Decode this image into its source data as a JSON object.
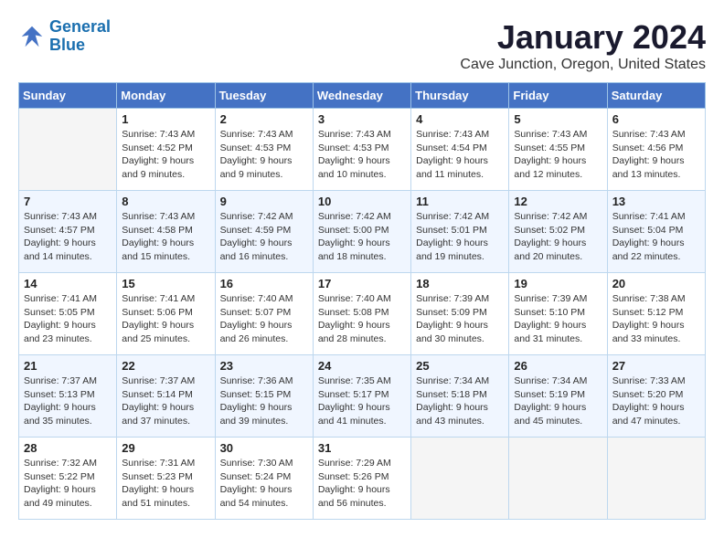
{
  "logo": {
    "line1": "General",
    "line2": "Blue"
  },
  "title": "January 2024",
  "subtitle": "Cave Junction, Oregon, United States",
  "days_of_week": [
    "Sunday",
    "Monday",
    "Tuesday",
    "Wednesday",
    "Thursday",
    "Friday",
    "Saturday"
  ],
  "weeks": [
    [
      {
        "num": "",
        "info": ""
      },
      {
        "num": "1",
        "info": "Sunrise: 7:43 AM\nSunset: 4:52 PM\nDaylight: 9 hours\nand 9 minutes."
      },
      {
        "num": "2",
        "info": "Sunrise: 7:43 AM\nSunset: 4:53 PM\nDaylight: 9 hours\nand 9 minutes."
      },
      {
        "num": "3",
        "info": "Sunrise: 7:43 AM\nSunset: 4:53 PM\nDaylight: 9 hours\nand 10 minutes."
      },
      {
        "num": "4",
        "info": "Sunrise: 7:43 AM\nSunset: 4:54 PM\nDaylight: 9 hours\nand 11 minutes."
      },
      {
        "num": "5",
        "info": "Sunrise: 7:43 AM\nSunset: 4:55 PM\nDaylight: 9 hours\nand 12 minutes."
      },
      {
        "num": "6",
        "info": "Sunrise: 7:43 AM\nSunset: 4:56 PM\nDaylight: 9 hours\nand 13 minutes."
      }
    ],
    [
      {
        "num": "7",
        "info": "Sunrise: 7:43 AM\nSunset: 4:57 PM\nDaylight: 9 hours\nand 14 minutes."
      },
      {
        "num": "8",
        "info": "Sunrise: 7:43 AM\nSunset: 4:58 PM\nDaylight: 9 hours\nand 15 minutes."
      },
      {
        "num": "9",
        "info": "Sunrise: 7:42 AM\nSunset: 4:59 PM\nDaylight: 9 hours\nand 16 minutes."
      },
      {
        "num": "10",
        "info": "Sunrise: 7:42 AM\nSunset: 5:00 PM\nDaylight: 9 hours\nand 18 minutes."
      },
      {
        "num": "11",
        "info": "Sunrise: 7:42 AM\nSunset: 5:01 PM\nDaylight: 9 hours\nand 19 minutes."
      },
      {
        "num": "12",
        "info": "Sunrise: 7:42 AM\nSunset: 5:02 PM\nDaylight: 9 hours\nand 20 minutes."
      },
      {
        "num": "13",
        "info": "Sunrise: 7:41 AM\nSunset: 5:04 PM\nDaylight: 9 hours\nand 22 minutes."
      }
    ],
    [
      {
        "num": "14",
        "info": "Sunrise: 7:41 AM\nSunset: 5:05 PM\nDaylight: 9 hours\nand 23 minutes."
      },
      {
        "num": "15",
        "info": "Sunrise: 7:41 AM\nSunset: 5:06 PM\nDaylight: 9 hours\nand 25 minutes."
      },
      {
        "num": "16",
        "info": "Sunrise: 7:40 AM\nSunset: 5:07 PM\nDaylight: 9 hours\nand 26 minutes."
      },
      {
        "num": "17",
        "info": "Sunrise: 7:40 AM\nSunset: 5:08 PM\nDaylight: 9 hours\nand 28 minutes."
      },
      {
        "num": "18",
        "info": "Sunrise: 7:39 AM\nSunset: 5:09 PM\nDaylight: 9 hours\nand 30 minutes."
      },
      {
        "num": "19",
        "info": "Sunrise: 7:39 AM\nSunset: 5:10 PM\nDaylight: 9 hours\nand 31 minutes."
      },
      {
        "num": "20",
        "info": "Sunrise: 7:38 AM\nSunset: 5:12 PM\nDaylight: 9 hours\nand 33 minutes."
      }
    ],
    [
      {
        "num": "21",
        "info": "Sunrise: 7:37 AM\nSunset: 5:13 PM\nDaylight: 9 hours\nand 35 minutes."
      },
      {
        "num": "22",
        "info": "Sunrise: 7:37 AM\nSunset: 5:14 PM\nDaylight: 9 hours\nand 37 minutes."
      },
      {
        "num": "23",
        "info": "Sunrise: 7:36 AM\nSunset: 5:15 PM\nDaylight: 9 hours\nand 39 minutes."
      },
      {
        "num": "24",
        "info": "Sunrise: 7:35 AM\nSunset: 5:17 PM\nDaylight: 9 hours\nand 41 minutes."
      },
      {
        "num": "25",
        "info": "Sunrise: 7:34 AM\nSunset: 5:18 PM\nDaylight: 9 hours\nand 43 minutes."
      },
      {
        "num": "26",
        "info": "Sunrise: 7:34 AM\nSunset: 5:19 PM\nDaylight: 9 hours\nand 45 minutes."
      },
      {
        "num": "27",
        "info": "Sunrise: 7:33 AM\nSunset: 5:20 PM\nDaylight: 9 hours\nand 47 minutes."
      }
    ],
    [
      {
        "num": "28",
        "info": "Sunrise: 7:32 AM\nSunset: 5:22 PM\nDaylight: 9 hours\nand 49 minutes."
      },
      {
        "num": "29",
        "info": "Sunrise: 7:31 AM\nSunset: 5:23 PM\nDaylight: 9 hours\nand 51 minutes."
      },
      {
        "num": "30",
        "info": "Sunrise: 7:30 AM\nSunset: 5:24 PM\nDaylight: 9 hours\nand 54 minutes."
      },
      {
        "num": "31",
        "info": "Sunrise: 7:29 AM\nSunset: 5:26 PM\nDaylight: 9 hours\nand 56 minutes."
      },
      {
        "num": "",
        "info": ""
      },
      {
        "num": "",
        "info": ""
      },
      {
        "num": "",
        "info": ""
      }
    ]
  ]
}
